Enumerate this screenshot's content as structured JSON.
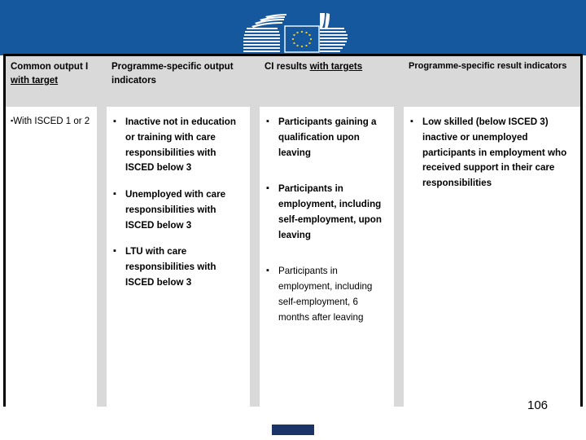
{
  "banner": {
    "logo_name": "european-commission-logo",
    "background_color": "#15589e",
    "flag_star_color": "#f7d117"
  },
  "table": {
    "headers": [
      {
        "pre": "Common output I ",
        "underlined": "with target",
        "post": ""
      },
      {
        "pre": "Programme-specific output indicators",
        "underlined": "",
        "post": ""
      },
      {
        "pre": "CI results ",
        "underlined": "with targets",
        "post": ""
      },
      {
        "pre": "Programme-specific result indicators",
        "underlined": "",
        "post": ""
      }
    ],
    "columns": [
      {
        "style": "plain",
        "items": [
          {
            "text": "With ISCED 1 or 2",
            "weight": "regular"
          }
        ]
      },
      {
        "style": "bulleted",
        "items": [
          {
            "text": "Inactive not in education or training with care responsibilities with ISCED below 3",
            "weight": "bold"
          },
          {
            "text": "Unemployed with care responsibilities with ISCED below 3",
            "weight": "bold"
          },
          {
            "text": "LTU with care responsibilities with ISCED below 3",
            "weight": "bold"
          }
        ]
      },
      {
        "style": "bulleted",
        "items": [
          {
            "text": "Participants gaining a qualification upon leaving",
            "weight": "bold"
          },
          {
            "text": "Participants in employment, including self-employment, upon leaving",
            "weight": "bold"
          },
          {
            "text": "Participants in employment, including self-employment, 6 months after leaving",
            "weight": "regular"
          }
        ]
      },
      {
        "style": "bulleted",
        "items": [
          {
            "text": "Low skilled (below ISCED 3) inactive or unemployed participants in employment who received support in their care responsibilities",
            "weight": "bold"
          }
        ]
      }
    ],
    "bullet_glyph": "▪"
  },
  "footer": {
    "page_number": "106",
    "accent_color": "#1b3468"
  }
}
